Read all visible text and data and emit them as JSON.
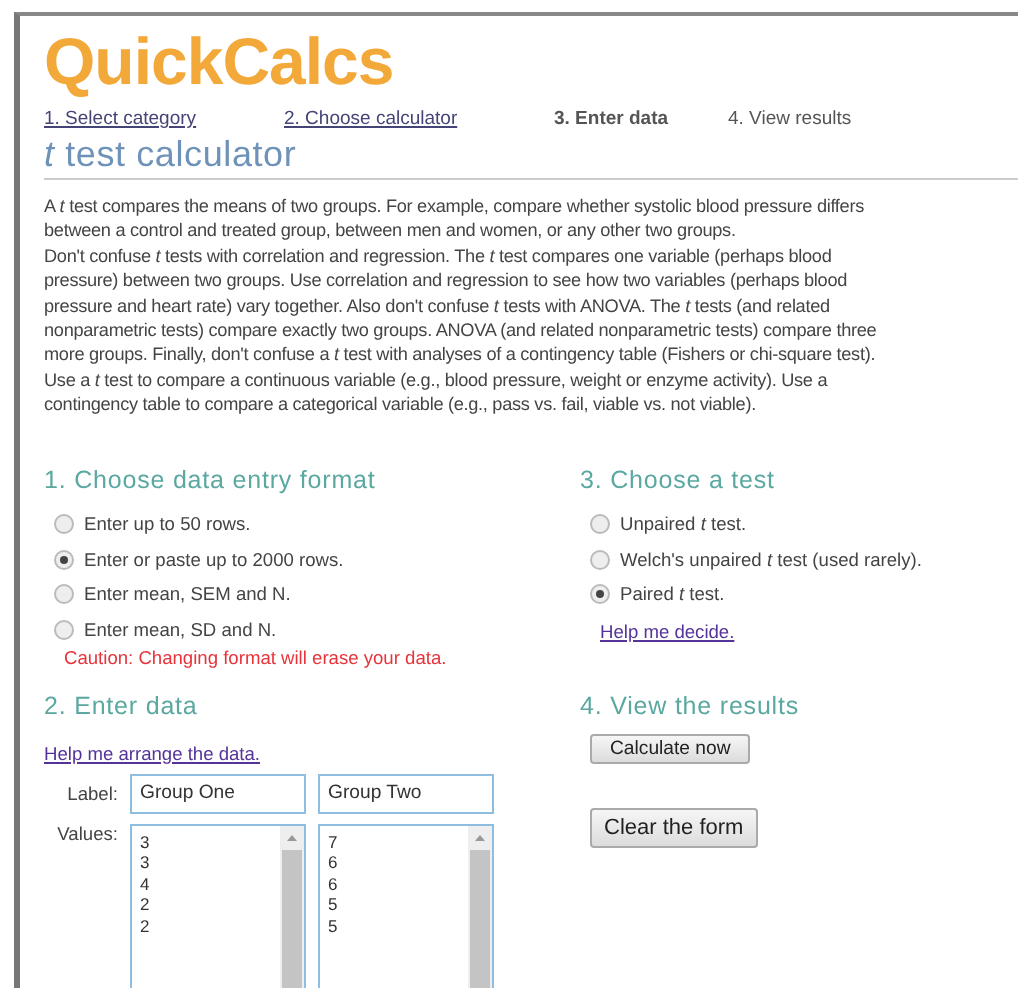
{
  "logo": "QuickCalcs",
  "steps": [
    {
      "label": "1. Select category",
      "kind": "link"
    },
    {
      "label": "2. Choose calculator",
      "kind": "link"
    },
    {
      "label": "3. Enter data",
      "kind": "current"
    },
    {
      "label": "4. View results",
      "kind": "upcoming"
    }
  ],
  "title": "*t* test calculator",
  "intro": [
    {
      "lines": [
        "A *t*  test compares the means of two groups. For example, compare whether systolic blood pressure differs",
        "between a control and treated group, between men and women, or any other two groups."
      ]
    },
    {
      "lines": [
        "Don't confuse *t*  tests with correlation and regression. The *t* test compares one variable (perhaps blood",
        "pressure) between two groups. Use correlation and regression to see how two variables (perhaps blood",
        "pressure and heart rate) vary together. Also don't confuse *t*  tests with ANOVA. The *t*  tests (and related",
        "nonparametric tests) compare exactly two groups. ANOVA (and related nonparametric tests) compare three",
        "more groups. Finally, don't confuse a *t* test with analyses of a contingency table (Fishers or chi-square test).",
        "Use a *t*  test to compare a continuous variable (e.g., blood pressure, weight or enzyme activity). Use a",
        "contingency table to compare a categorical variable (e.g., pass vs. fail, viable vs. not viable)."
      ]
    }
  ],
  "format_section": {
    "heading": "1. Choose data entry format",
    "options": [
      {
        "label": "Enter up to 50 rows.",
        "selected": false
      },
      {
        "label": "Enter or paste up to 2000 rows.",
        "selected": true
      },
      {
        "label": "Enter mean, SEM and N.",
        "selected": false
      },
      {
        "label": "Enter mean, SD and N.",
        "selected": false
      }
    ],
    "caution": "Caution: Changing format will erase your data."
  },
  "test_section": {
    "heading": "3. Choose a test",
    "options": [
      {
        "label": "Unpaired *t* test.",
        "selected": false
      },
      {
        "label": "Welch's unpaired *t* test (used rarely).",
        "selected": false
      },
      {
        "label": "Paired *t* test.",
        "selected": true
      }
    ],
    "help_link": "Help me decide."
  },
  "data_section": {
    "heading": "2. Enter data",
    "help_link": "Help me arrange the data.",
    "label_caption": "Label:",
    "values_caption": "Values:",
    "groups": [
      {
        "label": "Group One",
        "values": [
          "3",
          "3",
          "4",
          "2",
          "2"
        ]
      },
      {
        "label": "Group Two",
        "values": [
          "7",
          "6",
          "6",
          "5",
          "5"
        ]
      }
    ]
  },
  "results_section": {
    "heading": "4. View the results",
    "buttons": [
      "Calculate now",
      "Clear the form"
    ]
  }
}
